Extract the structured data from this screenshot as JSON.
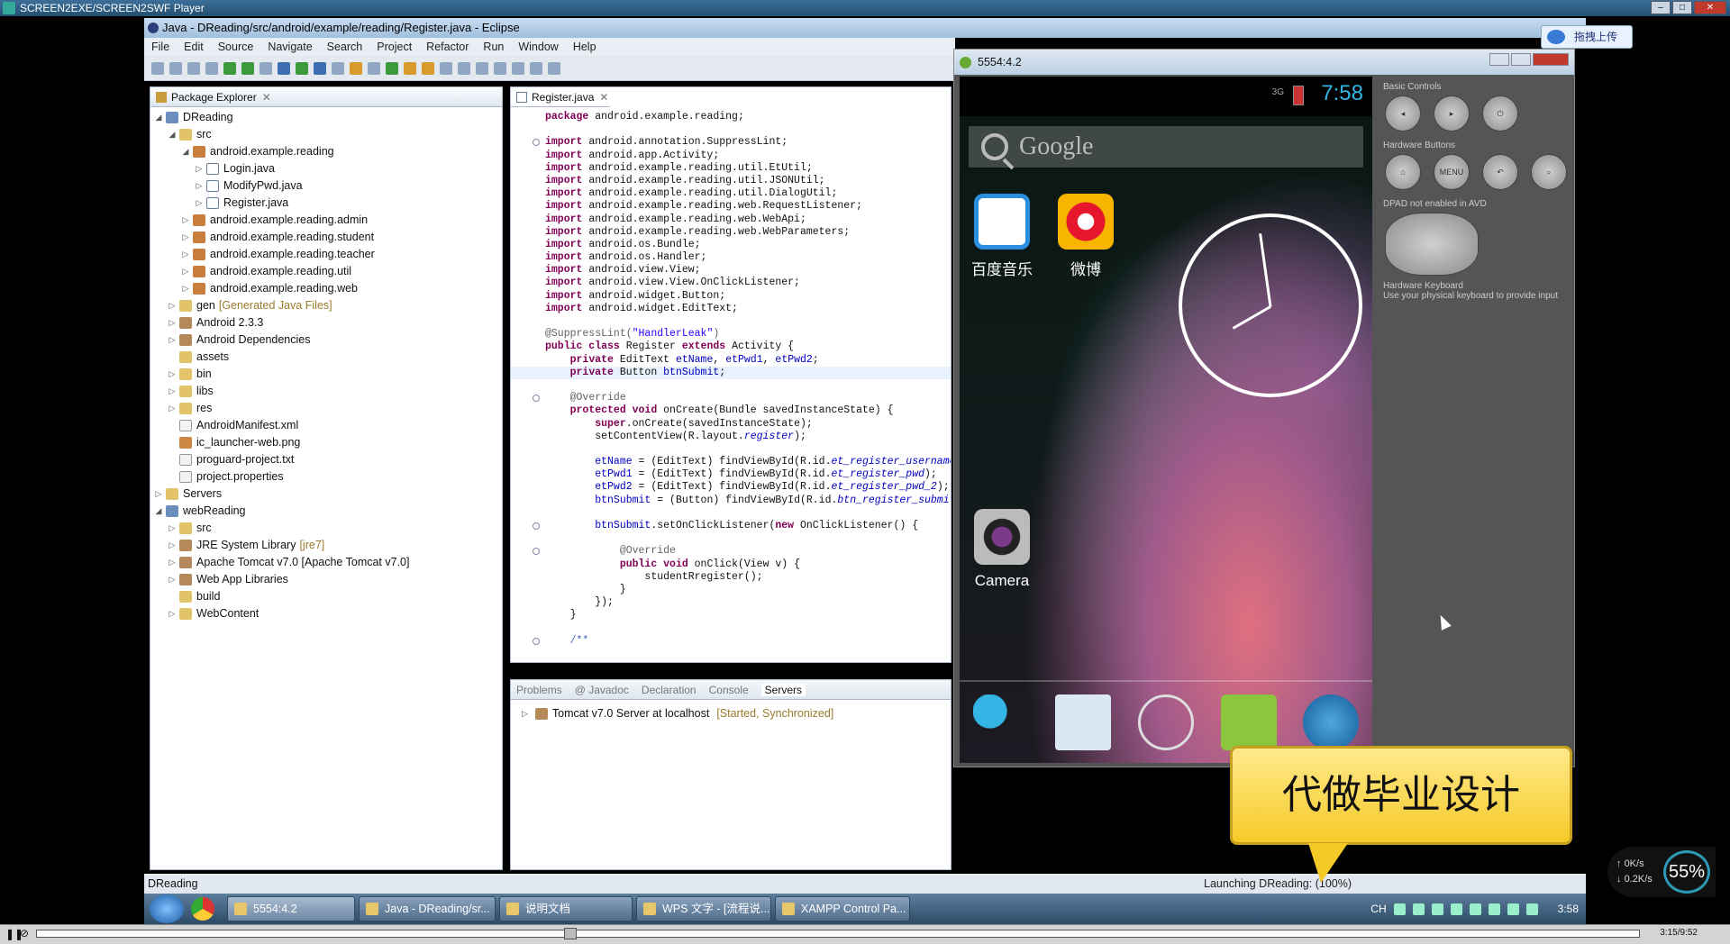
{
  "player": {
    "title": "SCREEN2EXE/SCREEN2SWF Player",
    "time": "3:15/9:52"
  },
  "eclipse": {
    "title": "Java - DReading/src/android/example/reading/Register.java - Eclipse",
    "menu": [
      "File",
      "Edit",
      "Source",
      "Navigate",
      "Search",
      "Project",
      "Refactor",
      "Run",
      "Window",
      "Help"
    ]
  },
  "package_explorer": {
    "title": "Package Explorer",
    "tree": [
      {
        "indent": 0,
        "tw": "◢",
        "icon": "t-proj",
        "label": "DReading"
      },
      {
        "indent": 1,
        "tw": "◢",
        "icon": "t-folder",
        "label": "src"
      },
      {
        "indent": 2,
        "tw": "◢",
        "icon": "t-pkg",
        "label": "android.example.reading"
      },
      {
        "indent": 3,
        "tw": "▷",
        "icon": "t-java",
        "label": "Login.java"
      },
      {
        "indent": 3,
        "tw": "▷",
        "icon": "t-java",
        "label": "ModifyPwd.java"
      },
      {
        "indent": 3,
        "tw": "▷",
        "icon": "t-java",
        "label": "Register.java"
      },
      {
        "indent": 2,
        "tw": "▷",
        "icon": "t-pkg",
        "label": "android.example.reading.admin"
      },
      {
        "indent": 2,
        "tw": "▷",
        "icon": "t-pkg",
        "label": "android.example.reading.student"
      },
      {
        "indent": 2,
        "tw": "▷",
        "icon": "t-pkg",
        "label": "android.example.reading.teacher"
      },
      {
        "indent": 2,
        "tw": "▷",
        "icon": "t-pkg",
        "label": "android.example.reading.util"
      },
      {
        "indent": 2,
        "tw": "▷",
        "icon": "t-pkg",
        "label": "android.example.reading.web"
      },
      {
        "indent": 1,
        "tw": "▷",
        "icon": "t-folder",
        "label": "gen",
        "dec": "[Generated Java Files]"
      },
      {
        "indent": 1,
        "tw": "▷",
        "icon": "t-lib",
        "label": "Android 2.3.3"
      },
      {
        "indent": 1,
        "tw": "▷",
        "icon": "t-lib",
        "label": "Android Dependencies"
      },
      {
        "indent": 1,
        "tw": "",
        "icon": "t-folder",
        "label": "assets"
      },
      {
        "indent": 1,
        "tw": "▷",
        "icon": "t-folder",
        "label": "bin"
      },
      {
        "indent": 1,
        "tw": "▷",
        "icon": "t-folder",
        "label": "libs"
      },
      {
        "indent": 1,
        "tw": "▷",
        "icon": "t-folder",
        "label": "res"
      },
      {
        "indent": 1,
        "tw": "",
        "icon": "t-file",
        "label": "AndroidManifest.xml"
      },
      {
        "indent": 1,
        "tw": "",
        "icon": "t-img",
        "label": "ic_launcher-web.png"
      },
      {
        "indent": 1,
        "tw": "",
        "icon": "t-file",
        "label": "proguard-project.txt"
      },
      {
        "indent": 1,
        "tw": "",
        "icon": "t-file",
        "label": "project.properties"
      },
      {
        "indent": 0,
        "tw": "▷",
        "icon": "t-folder",
        "label": "Servers"
      },
      {
        "indent": 0,
        "tw": "◢",
        "icon": "t-proj",
        "label": "webReading"
      },
      {
        "indent": 1,
        "tw": "▷",
        "icon": "t-folder",
        "label": "src"
      },
      {
        "indent": 1,
        "tw": "▷",
        "icon": "t-lib",
        "label": "JRE System Library",
        "dec": "[jre7]"
      },
      {
        "indent": 1,
        "tw": "▷",
        "icon": "t-lib",
        "label": "Apache Tomcat v7.0 [Apache Tomcat v7.0]"
      },
      {
        "indent": 1,
        "tw": "▷",
        "icon": "t-lib",
        "label": "Web App Libraries"
      },
      {
        "indent": 1,
        "tw": "",
        "icon": "t-folder",
        "label": "build"
      },
      {
        "indent": 1,
        "tw": "▷",
        "icon": "t-folder",
        "label": "WebContent"
      }
    ]
  },
  "editor": {
    "tab": "Register.java",
    "lines": [
      [
        [
          "kw",
          "package "
        ],
        [
          "",
          "android.example.reading;"
        ]
      ],
      [],
      [
        [
          "kw",
          "import "
        ],
        [
          "",
          "android.annotation.SuppressLint;"
        ]
      ],
      [
        [
          "kw",
          "import "
        ],
        [
          "",
          "android.app.Activity;"
        ]
      ],
      [
        [
          "kw",
          "import "
        ],
        [
          "",
          "android.example.reading.util.EtUtil;"
        ]
      ],
      [
        [
          "kw",
          "import "
        ],
        [
          "",
          "android.example.reading.util.JSONUtil;"
        ]
      ],
      [
        [
          "kw",
          "import "
        ],
        [
          "",
          "android.example.reading.util.DialogUtil;"
        ]
      ],
      [
        [
          "kw",
          "import "
        ],
        [
          "",
          "android.example.reading.web.RequestListener;"
        ]
      ],
      [
        [
          "kw",
          "import "
        ],
        [
          "",
          "android.example.reading.web.WebApi;"
        ]
      ],
      [
        [
          "kw",
          "import "
        ],
        [
          "",
          "android.example.reading.web.WebParameters;"
        ]
      ],
      [
        [
          "kw",
          "import "
        ],
        [
          "",
          "android.os.Bundle;"
        ]
      ],
      [
        [
          "kw",
          "import "
        ],
        [
          "",
          "android.os.Handler;"
        ]
      ],
      [
        [
          "kw",
          "import "
        ],
        [
          "",
          "android.view.View;"
        ]
      ],
      [
        [
          "kw",
          "import "
        ],
        [
          "",
          "android.view.View.OnClickListener;"
        ]
      ],
      [
        [
          "kw",
          "import "
        ],
        [
          "",
          "android.widget.Button;"
        ]
      ],
      [
        [
          "kw",
          "import "
        ],
        [
          "",
          "android.widget.EditText;"
        ]
      ],
      [],
      [
        [
          "ann",
          "@SuppressLint("
        ],
        [
          "str",
          "\"HandlerLeak\""
        ],
        [
          "ann",
          ")"
        ]
      ],
      [
        [
          "kw",
          "public class "
        ],
        [
          "",
          "Register "
        ],
        [
          "kw",
          "extends "
        ],
        [
          "",
          "Activity {"
        ]
      ],
      [
        [
          "",
          "    "
        ],
        [
          "kw",
          "private "
        ],
        [
          "",
          "EditText "
        ],
        [
          "fld",
          "etName"
        ],
        [
          "",
          ", "
        ],
        [
          "fld",
          "etPwd1"
        ],
        [
          "",
          ", "
        ],
        [
          "fld",
          "etPwd2"
        ],
        [
          "",
          ";"
        ]
      ],
      [
        [
          "",
          "    "
        ],
        [
          "kw",
          "private "
        ],
        [
          "",
          "Button "
        ],
        [
          "fld",
          "btnSubmit"
        ],
        [
          "",
          ";"
        ]
      ],
      [],
      [
        [
          "",
          "    "
        ],
        [
          "ann",
          "@Override"
        ]
      ],
      [
        [
          "",
          "    "
        ],
        [
          "kw",
          "protected void "
        ],
        [
          "",
          "onCreate(Bundle savedInstanceState) {"
        ]
      ],
      [
        [
          "",
          "        "
        ],
        [
          "kw",
          "super"
        ],
        [
          "",
          ".onCreate(savedInstanceState);"
        ]
      ],
      [
        [
          "",
          "        setContentView(R.layout."
        ],
        [
          "ital",
          "register"
        ],
        [
          "",
          ");"
        ]
      ],
      [],
      [
        [
          "",
          "        "
        ],
        [
          "fld",
          "etName"
        ],
        [
          "",
          " = (EditText) findViewById(R.id."
        ],
        [
          "ital",
          "et_register_username"
        ],
        [
          "",
          ");"
        ]
      ],
      [
        [
          "",
          "        "
        ],
        [
          "fld",
          "etPwd1"
        ],
        [
          "",
          " = (EditText) findViewById(R.id."
        ],
        [
          "ital",
          "et_register_pwd"
        ],
        [
          "",
          ");"
        ]
      ],
      [
        [
          "",
          "        "
        ],
        [
          "fld",
          "etPwd2"
        ],
        [
          "",
          " = (EditText) findViewById(R.id."
        ],
        [
          "ital",
          "et_register_pwd_2"
        ],
        [
          "",
          ");"
        ]
      ],
      [
        [
          "",
          "        "
        ],
        [
          "fld",
          "btnSubmit"
        ],
        [
          "",
          " = (Button) findViewById(R.id."
        ],
        [
          "ital",
          "btn_register_submit"
        ],
        [
          "",
          ");"
        ]
      ],
      [],
      [
        [
          "",
          "        "
        ],
        [
          "fld",
          "btnSubmit"
        ],
        [
          "",
          ".setOnClickListener("
        ],
        [
          "kw",
          "new "
        ],
        [
          "",
          "OnClickListener() {"
        ]
      ],
      [],
      [
        [
          "",
          "            "
        ],
        [
          "ann",
          "@Override"
        ]
      ],
      [
        [
          "",
          "            "
        ],
        [
          "kw",
          "public void "
        ],
        [
          "",
          "onClick(View v) {"
        ]
      ],
      [
        [
          "",
          "                studentRregister();"
        ]
      ],
      [
        [
          "",
          "            }"
        ]
      ],
      [
        [
          "",
          "        });"
        ]
      ],
      [
        [
          "",
          "    }"
        ]
      ],
      [],
      [
        [
          "",
          "    "
        ],
        [
          "cm",
          "/**"
        ]
      ]
    ]
  },
  "bottom_panel": {
    "tabs": [
      "Problems",
      "@ Javadoc",
      "Declaration",
      "Console",
      "Servers"
    ],
    "server_name": "Tomcat v7.0 Server at localhost",
    "server_status": "[Started, Synchronized]"
  },
  "status": {
    "left": "DReading",
    "right": "Launching DReading: (100%)"
  },
  "taskbar": {
    "tasks": [
      "5554:4.2",
      "Java - DReading/sr...",
      "说明文档",
      "WPS 文字 - [流程说...",
      "XAMPP Control Pa..."
    ],
    "ime": "CH",
    "clock": "3:58"
  },
  "emulator": {
    "title": "5554:4.2",
    "net": "3G",
    "time": "7:58",
    "search_placeholder": "Google",
    "apps": [
      {
        "label": "百度音乐"
      },
      {
        "label": "微博"
      }
    ],
    "camera": "Camera",
    "controls": {
      "basic": "Basic Controls",
      "hardware": "Hardware Buttons",
      "menu": "MENU",
      "dpad": "DPAD not enabled in AVD",
      "keyboard_title": "Hardware Keyboard",
      "keyboard_sub": "Use your physical keyboard to provide input"
    }
  },
  "overlay": {
    "bubble_text": "代做毕业设计",
    "upload": "拖拽上传",
    "net_up": "0K/s",
    "net_down": "0.2K/s",
    "net_pct": "55%"
  },
  "colors": {
    "accent": "#33b5e5",
    "keyword": "#7f0055",
    "field": "#0000c0"
  }
}
